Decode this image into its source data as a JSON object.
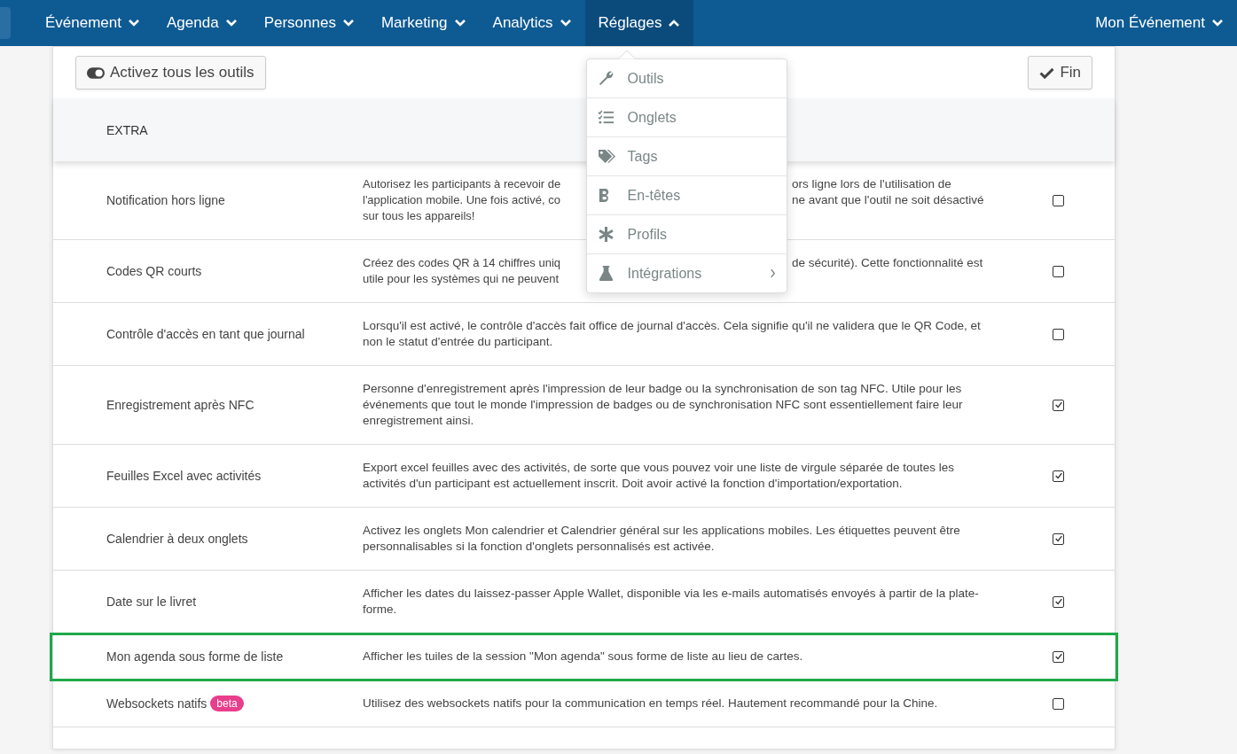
{
  "nav": {
    "items": [
      {
        "label": "Événement",
        "expanded": false
      },
      {
        "label": "Agenda",
        "expanded": false
      },
      {
        "label": "Personnes",
        "expanded": false
      },
      {
        "label": "Marketing",
        "expanded": false
      },
      {
        "label": "Analytics",
        "expanded": false
      },
      {
        "label": "Réglages",
        "expanded": true
      }
    ],
    "event": "Mon Événement"
  },
  "menu": {
    "items": [
      {
        "label": "Outils",
        "submenu": false
      },
      {
        "label": "Onglets",
        "submenu": false
      },
      {
        "label": "Tags",
        "submenu": false
      },
      {
        "label": "En-têtes",
        "submenu": false
      },
      {
        "label": "Profils",
        "submenu": false
      },
      {
        "label": "Intégrations",
        "submenu": true
      }
    ]
  },
  "toolbar": {
    "toggle_all": "Activez tous les outils",
    "done": "Fin"
  },
  "section": "EXTRA",
  "rows": [
    {
      "name": "Notification hors ligne",
      "lines": [
        {
          "left": "Autorisez les participants à recevoir de",
          "right": "ors ligne lors de l'utilisation de"
        },
        {
          "left": "l'application mobile. Une fois activé, co",
          "right": "ne avant que l'outil ne soit désactivé"
        },
        {
          "left": "sur tous les appareils!"
        }
      ],
      "checked": false,
      "highlighted": false
    },
    {
      "name": "Codes QR courts",
      "lines": [
        {
          "left": "Créez des codes QR à 14 chiffres uniq",
          "right": "de sécurité). Cette fonctionnalité est"
        },
        {
          "left": "utile pour les systèmes qui ne peuvent"
        }
      ],
      "checked": false,
      "highlighted": false
    },
    {
      "name": "Contrôle d'accès en tant que journal",
      "description": "Lorsqu'il est activé, le contrôle d'accès fait office de journal d'accès. Cela signifie qu'il ne validera que le QR Code, et non le statut d'entrée du participant.",
      "checked": false,
      "highlighted": false
    },
    {
      "name": "Enregistrement après NFC",
      "description": "Personne d'enregistrement après l'impression de leur badge ou la synchronisation de son tag NFC. Utile pour les événements que tout le monde l'impression de badges ou de synchronisation NFC sont essentiellement faire leur enregistrement ainsi.",
      "checked": true,
      "highlighted": false
    },
    {
      "name": "Feuilles Excel avec activités",
      "description": "Export excel feuilles avec des activités, de sorte que vous pouvez voir une liste de virgule séparée de toutes les activités d'un participant est actuellement inscrit. Doit avoir activé la fonction d'importation/exportation.",
      "checked": true,
      "highlighted": false
    },
    {
      "name": "Calendrier à deux onglets",
      "description": "Activez les onglets Mon calendrier et Calendrier général sur les applications mobiles. Les étiquettes peuvent être personnalisables si la fonction d'onglets personnalisés est activée.",
      "checked": true,
      "highlighted": false
    },
    {
      "name": "Date sur le livret",
      "description": "Afficher les dates du laissez-passer Apple Wallet, disponible via les e-mails automatisés envoyés à partir de la plate-forme.",
      "checked": true,
      "highlighted": false
    },
    {
      "name": "Mon agenda sous forme de liste",
      "description": "Afficher les tuiles de la session \"Mon agenda\" sous forme de liste au lieu de cartes.",
      "checked": true,
      "highlighted": true
    },
    {
      "name": "Websockets natifs",
      "badge": "beta",
      "description": "Utilisez des websockets natifs pour la communication en temps réel. Hautement recommandé pour la Chine.",
      "checked": false,
      "highlighted": false
    }
  ]
}
